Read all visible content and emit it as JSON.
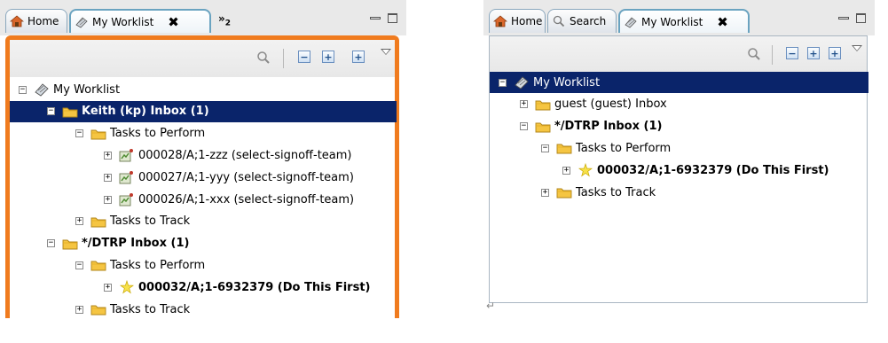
{
  "left": {
    "tabs": [
      {
        "label": "Home",
        "icon": "home-icon"
      },
      {
        "label": "My Worklist",
        "icon": "worklist-icon",
        "close": "✖"
      }
    ],
    "overflow": {
      "chevrons": "»",
      "count": "2"
    },
    "tree": [
      {
        "label": "My Worklist",
        "toggle": "−",
        "icon": "worklist-icon"
      },
      {
        "label": "Keith (kp) Inbox (1)",
        "toggle": "−",
        "icon": "folder-icon",
        "bold": true,
        "selected": true
      },
      {
        "label": "Tasks to Perform",
        "toggle": "−",
        "icon": "folder-icon"
      },
      {
        "label": "000028/A;1-zzz (select-signoff-team)",
        "toggle": "+",
        "icon": "task-icon"
      },
      {
        "label": "000027/A;1-yyy (select-signoff-team)",
        "toggle": "+",
        "icon": "task-icon"
      },
      {
        "label": "000026/A;1-xxx (select-signoff-team)",
        "toggle": "+",
        "icon": "task-icon"
      },
      {
        "label": "Tasks to Track",
        "toggle": "+",
        "icon": "folder-icon"
      },
      {
        "label": "*/DTRP Inbox (1)",
        "toggle": "−",
        "icon": "folder-icon",
        "bold": true
      },
      {
        "label": "Tasks to Perform",
        "toggle": "−",
        "icon": "folder-icon"
      },
      {
        "label": "000032/A;1-6932379 (Do This First)",
        "toggle": "+",
        "icon": "star-icon",
        "bold": true
      },
      {
        "label": "Tasks to Track",
        "toggle": "+",
        "icon": "folder-icon"
      }
    ]
  },
  "right": {
    "tabs": [
      {
        "label": "Home",
        "icon": "home-icon"
      },
      {
        "label": "Search",
        "icon": "search-icon"
      },
      {
        "label": "My Worklist",
        "icon": "worklist-icon",
        "close": "✖"
      }
    ],
    "tree": [
      {
        "label": "My Worklist",
        "toggle": "−",
        "icon": "worklist-icon",
        "selected": true
      },
      {
        "label": "guest (guest) Inbox",
        "toggle": "+",
        "icon": "folder-icon"
      },
      {
        "label": "*/DTRP Inbox (1)",
        "toggle": "−",
        "icon": "folder-icon",
        "bold": true
      },
      {
        "label": "Tasks to Perform",
        "toggle": "−",
        "icon": "folder-icon"
      },
      {
        "label": "000032/A;1-6932379 (Do This First)",
        "toggle": "+",
        "icon": "star-icon",
        "bold": true
      },
      {
        "label": "Tasks to Track",
        "toggle": "+",
        "icon": "folder-icon"
      }
    ]
  },
  "toolbar": {
    "plus": "+",
    "minus": "−"
  },
  "colors": {
    "selection": "#0a246a",
    "active_frame": "#f07b1e",
    "folder": "#f5c542"
  },
  "paragraph_mark": "↵"
}
